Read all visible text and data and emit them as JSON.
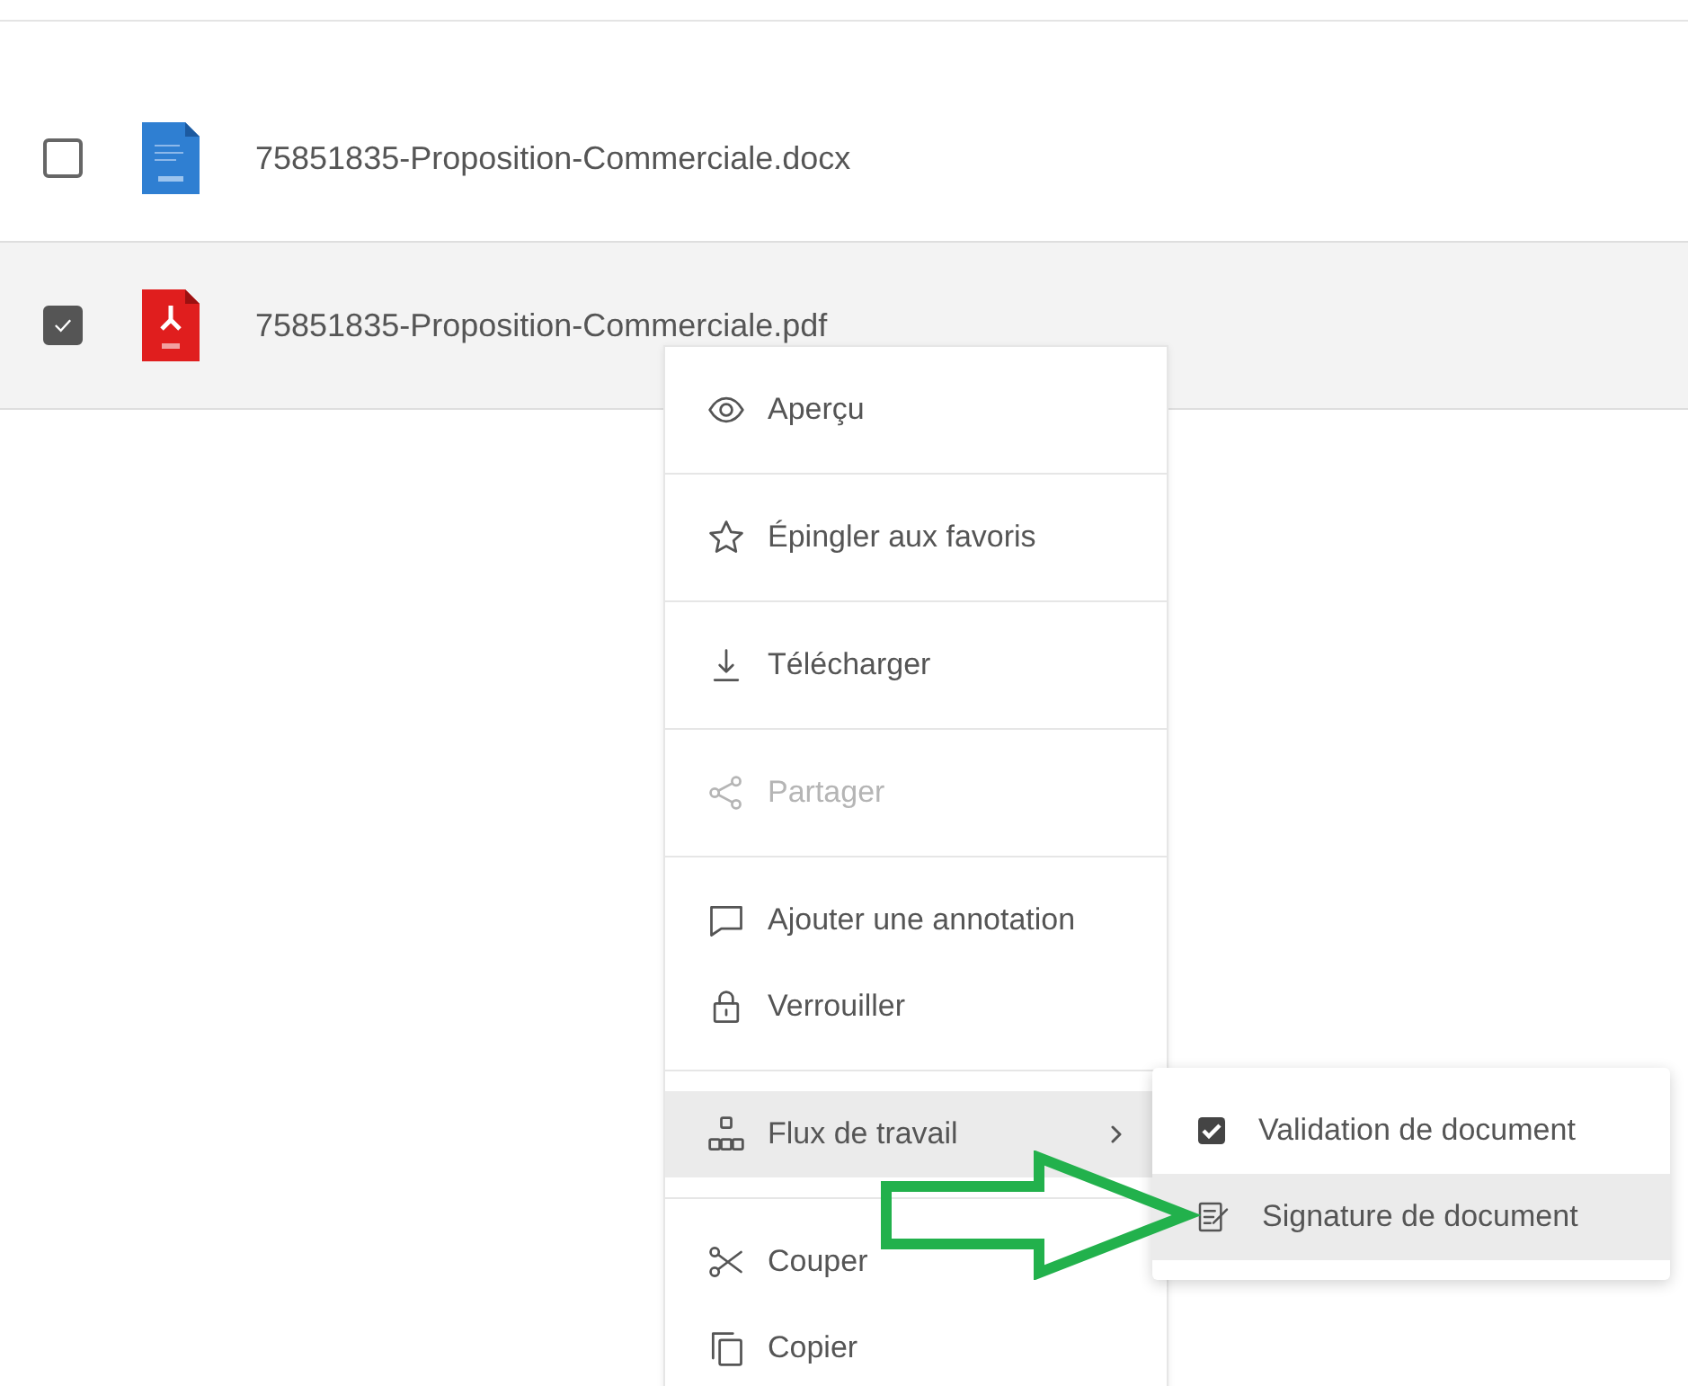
{
  "files": [
    {
      "name": "75851835-Proposition-Commerciale.docx",
      "kind": "docx",
      "checked": false,
      "selected": false
    },
    {
      "name": "75851835-Proposition-Commerciale.pdf",
      "kind": "pdf",
      "checked": true,
      "selected": true
    }
  ],
  "context_menu": {
    "groups": [
      [
        {
          "label": "Aperçu",
          "kind": "preview",
          "disabled": false,
          "selected": false
        }
      ],
      [
        {
          "label": "Épingler aux favoris",
          "kind": "pin",
          "disabled": false,
          "selected": false
        }
      ],
      [
        {
          "label": "Télécharger",
          "kind": "download",
          "disabled": false,
          "selected": false
        }
      ],
      [
        {
          "label": "Partager",
          "kind": "share",
          "disabled": true,
          "selected": false
        }
      ],
      [
        {
          "label": "Ajouter une annotation",
          "kind": "annotate",
          "disabled": false,
          "selected": false
        },
        {
          "label": "Verrouiller",
          "kind": "lock",
          "disabled": false,
          "selected": false
        }
      ],
      [
        {
          "label": "Flux de travail",
          "kind": "workflow",
          "disabled": false,
          "selected": true,
          "submenu": true
        }
      ],
      [
        {
          "label": "Couper",
          "kind": "cut",
          "disabled": false,
          "selected": false
        },
        {
          "label": "Copier",
          "kind": "copy",
          "disabled": false,
          "selected": false
        }
      ]
    ]
  },
  "submenu": {
    "items": [
      {
        "label": "Validation de document",
        "kind": "validate",
        "selected": false
      },
      {
        "label": "Signature de document",
        "kind": "sign",
        "selected": true
      }
    ]
  }
}
